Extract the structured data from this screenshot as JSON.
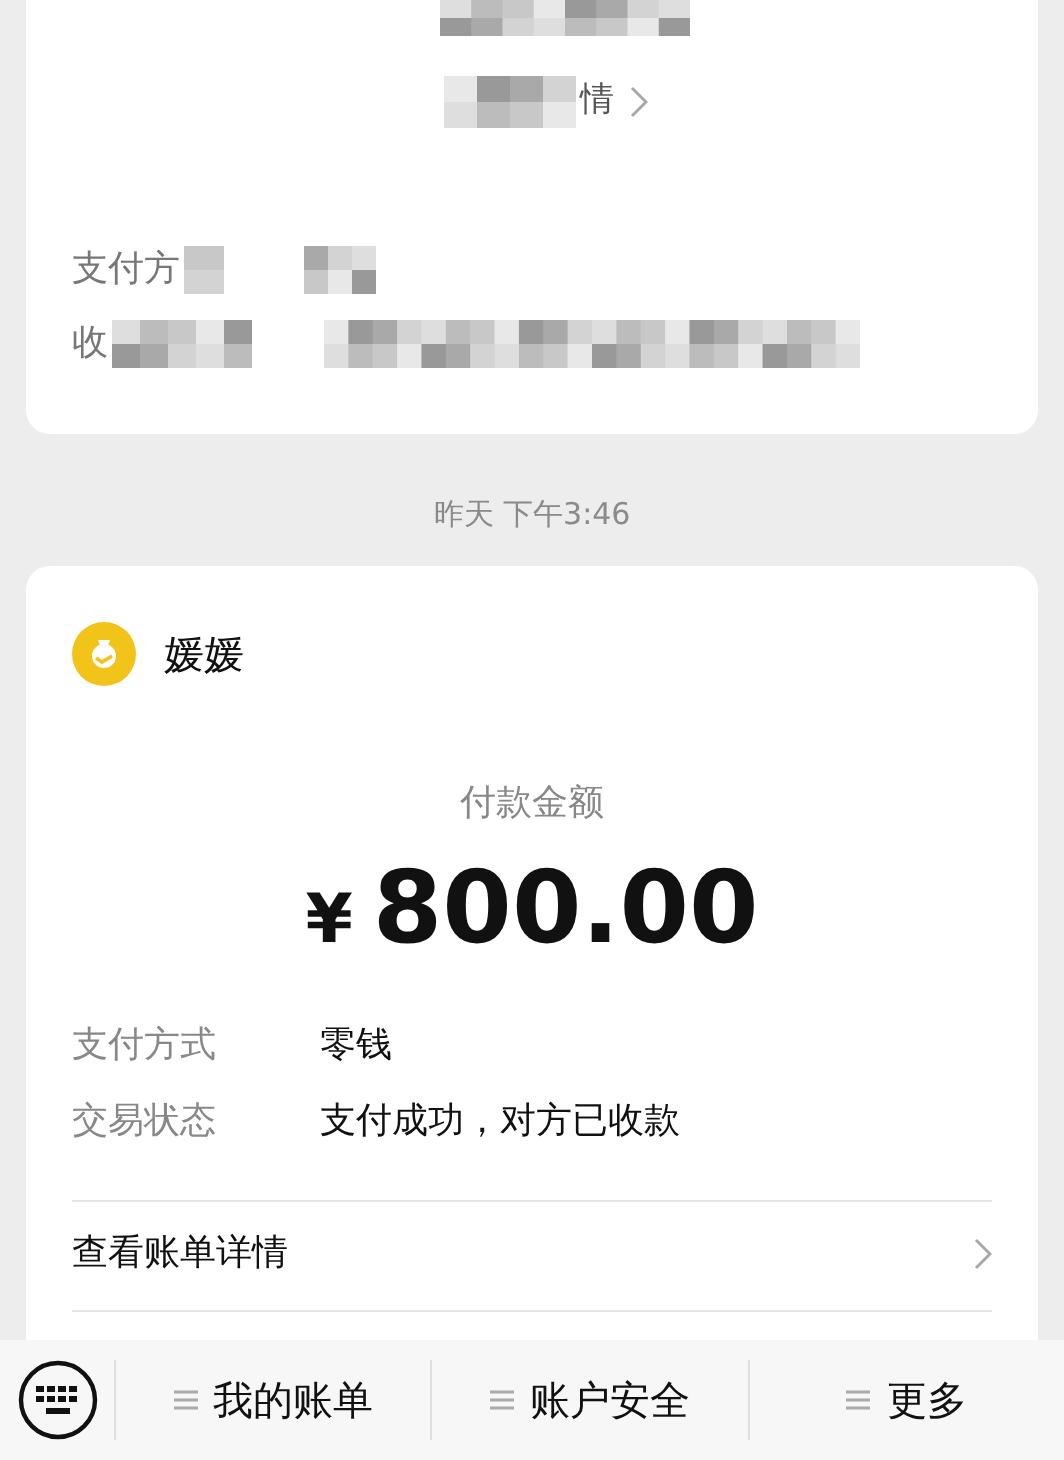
{
  "previous_card": {
    "detail_link": "情",
    "rows": [
      {
        "label": "支付方"
      },
      {
        "label": "收"
      }
    ]
  },
  "timestamp": "昨天 下午3:46",
  "payment_card": {
    "payee": "媛媛",
    "amount_label": "付款金额",
    "currency": "¥",
    "amount": "800.00",
    "rows": [
      {
        "label": "支付方式",
        "value": "零钱"
      },
      {
        "label": "交易状态",
        "value": "支付成功，对方已收款"
      }
    ],
    "detail_link": "查看账单详情"
  },
  "bottom_menu": {
    "items": [
      {
        "label": "我的账单"
      },
      {
        "label": "账户安全"
      },
      {
        "label": "更多"
      }
    ]
  }
}
